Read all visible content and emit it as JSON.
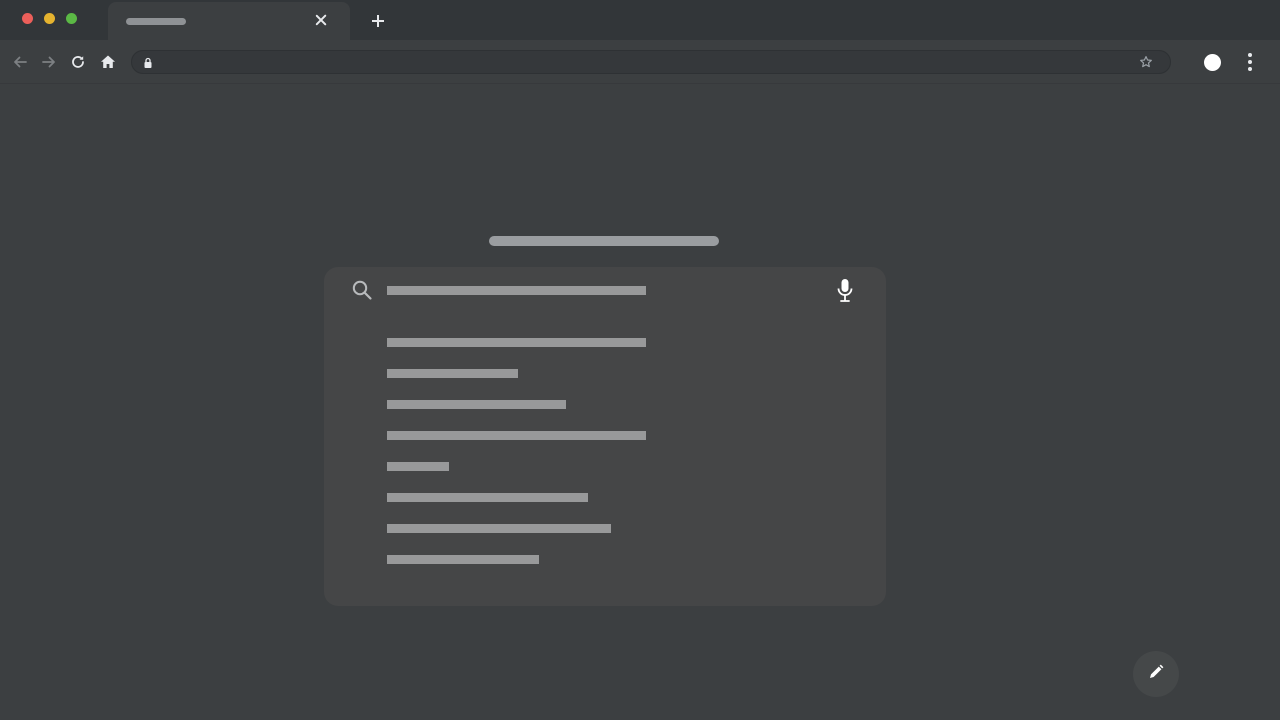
{
  "colors": {
    "tabstrip_bg": "#323639",
    "page_bg": "#3c3f41",
    "panel_bg": "#454647",
    "placeholder_bar": "#98999a",
    "icon": "#e8eaed"
  },
  "window_controls": [
    "close",
    "minimize",
    "maximize"
  ],
  "tabs": [
    {
      "title": "",
      "active": true
    }
  ],
  "toolbar": {
    "icons": [
      "back-icon",
      "forward-icon",
      "reload-icon",
      "home-icon",
      "lock-icon",
      "star-icon",
      "profile-avatar",
      "menu-icon"
    ],
    "url": ""
  },
  "page": {
    "title": "",
    "search": {
      "placeholder": "",
      "icons": [
        "search-icon",
        "microphone-icon"
      ],
      "suggestions": [
        "",
        "",
        "",
        "",
        "",
        "",
        "",
        ""
      ]
    },
    "edit_icon": "pencil-icon"
  }
}
